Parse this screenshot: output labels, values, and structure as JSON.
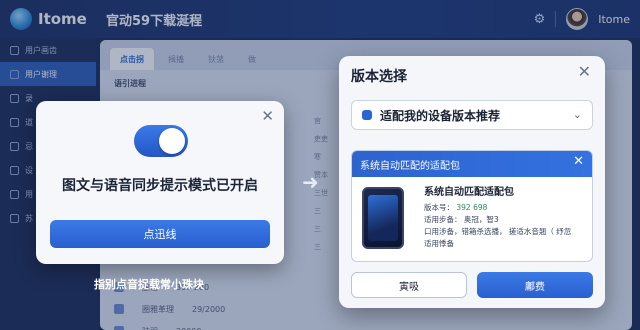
{
  "app": {
    "logo_text": "Itome",
    "title": "官动59下载涎程",
    "user_name": "Itome"
  },
  "sidebar": {
    "items": [
      {
        "label": "用户画齿"
      },
      {
        "label": "用户谢理",
        "active": true
      },
      {
        "label": "录"
      },
      {
        "label": "道"
      },
      {
        "label": "忌"
      },
      {
        "label": "设"
      },
      {
        "label": "用"
      },
      {
        "label": "苏"
      }
    ]
  },
  "main": {
    "tabs": [
      {
        "label": "点击拐",
        "active": true
      },
      {
        "label": "揖搐"
      },
      {
        "label": "钬蒎"
      },
      {
        "label": "做"
      }
    ],
    "section_title": "语引进程",
    "column_cells": [
      "官",
      "吏吏",
      "寒",
      "赞本",
      "三世",
      "三",
      "三",
      "三"
    ],
    "bottom_rows": [
      {
        "label": "酿谂",
        "value": "390 280"
      },
      {
        "label": "圈雅革理",
        "value": "29/2000"
      },
      {
        "label": "驻弱",
        "value": "20000"
      }
    ]
  },
  "toast": {
    "message": "图文与语音同步提示模式已开启",
    "button_label": "点迅线",
    "toggle_on": true
  },
  "caption": "指别点音捉载常小珠块",
  "dialog": {
    "title": "版本选择",
    "select_value": "适配我的设备版本推荐",
    "subcard": {
      "header": "系统自动匹配的适配包",
      "title": "系统自动匹配适配包",
      "version_label": "版本号：",
      "version_value": "392 698",
      "steps_label": "适用步备：",
      "steps_value": "奥冠，智3",
      "line3": "口用涉备，错箱杀选播， 搓适水音翘（ 纾忽",
      "line4": "适用悸备"
    },
    "cancel_label": "寅吸",
    "ok_label": "鄘费"
  },
  "colors": {
    "accent": "#2c63cf",
    "sidebar_bg": "#1b2b57",
    "topbar_bg": "#1d3a7a"
  }
}
